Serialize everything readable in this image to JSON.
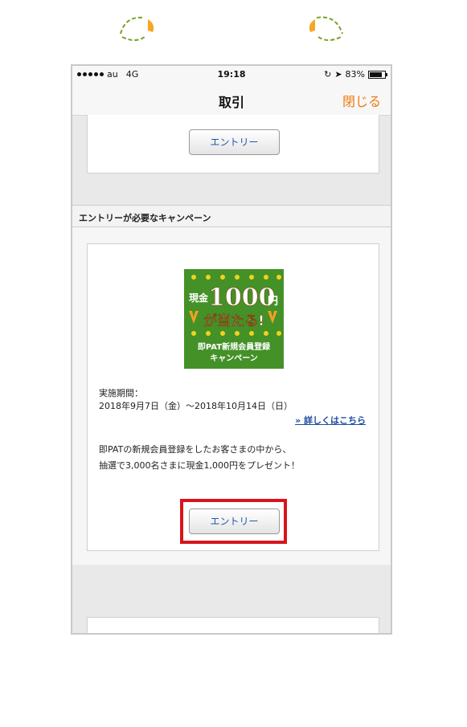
{
  "status_bar": {
    "carrier": "au",
    "network": "4G",
    "time": "19:18",
    "battery_percent": "83%",
    "battery_level": 0.83
  },
  "navbar": {
    "title": "取引",
    "close_label": "閉じる",
    "accent_color": "#f07a10"
  },
  "top_card": {
    "entry_button": "エントリー"
  },
  "section": {
    "header": "エントリーが必要なキャンペーン"
  },
  "campaign": {
    "banner": {
      "prefix": "現金",
      "amount": "1,000",
      "amount_display": "1000",
      "yen": "円",
      "line2": "が当たる!",
      "line3": "即PAT新規会員登録",
      "line4": "キャンペーン"
    },
    "period_label": "実施期間：",
    "period": "2018年9月7日（金）～2018年10月14日（日）",
    "detail_link": "» 詳しくはこちら",
    "description_line1": "即PATの新規会員登録をしたお客さまの中から、",
    "description_line2": "抽選で3,000名さまに現金1,000円をプレゼント！",
    "entry_button": "エントリー",
    "highlight_color": "#d8141b"
  }
}
